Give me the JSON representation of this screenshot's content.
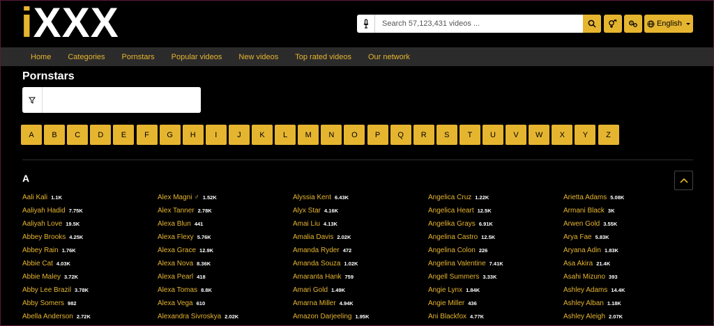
{
  "header": {
    "logo_i": "i",
    "logo_rest": "XXX",
    "search_placeholder": "Search 57,123,431 videos ...",
    "language": "English"
  },
  "nav": [
    "Home",
    "Categories",
    "Pornstars",
    "Popular videos",
    "New videos",
    "Top rated videos",
    "Our network"
  ],
  "page_title": "Pornstars",
  "letters": [
    "A",
    "B",
    "C",
    "D",
    "E",
    "F",
    "G",
    "H",
    "I",
    "J",
    "K",
    "L",
    "M",
    "N",
    "O",
    "P",
    "Q",
    "R",
    "S",
    "T",
    "U",
    "V",
    "W",
    "X",
    "Y",
    "Z"
  ],
  "section_letter": "A",
  "columns": [
    [
      {
        "name": "Aali Kali",
        "count": "1.1K"
      },
      {
        "name": "Aaliyah Hadid",
        "count": "7.75K"
      },
      {
        "name": "Aaliyah Love",
        "count": "19.5K"
      },
      {
        "name": "Abbey Brooks",
        "count": "4.25K"
      },
      {
        "name": "Abbey Rain",
        "count": "1.76K"
      },
      {
        "name": "Abbie Cat",
        "count": "4.03K"
      },
      {
        "name": "Abbie Maley",
        "count": "3.72K"
      },
      {
        "name": "Abby Lee Brazil",
        "count": "3.78K"
      },
      {
        "name": "Abby Somers",
        "count": "982"
      },
      {
        "name": "Abella Anderson",
        "count": "2.72K"
      }
    ],
    [
      {
        "name": "Alex Magni ♂",
        "count": "1.52K"
      },
      {
        "name": "Alex Tanner",
        "count": "2.78K"
      },
      {
        "name": "Alexa Blun",
        "count": "441"
      },
      {
        "name": "Alexa Flexy",
        "count": "5.76K"
      },
      {
        "name": "Alexa Grace",
        "count": "12.9K"
      },
      {
        "name": "Alexa Nova",
        "count": "8.36K"
      },
      {
        "name": "Alexa Pearl",
        "count": "418"
      },
      {
        "name": "Alexa Tomas",
        "count": "8.8K"
      },
      {
        "name": "Alexa Vega",
        "count": "610"
      },
      {
        "name": "Alexandra Sivroskya",
        "count": "2.02K"
      }
    ],
    [
      {
        "name": "Alyssia Kent",
        "count": "6.43K"
      },
      {
        "name": "Alyx Star",
        "count": "4.16K"
      },
      {
        "name": "Amai Liu",
        "count": "4.13K"
      },
      {
        "name": "Amalia Davis",
        "count": "2.02K"
      },
      {
        "name": "Amanda Ryder",
        "count": "472"
      },
      {
        "name": "Amanda Souza",
        "count": "1.02K"
      },
      {
        "name": "Amaranta Hank",
        "count": "759"
      },
      {
        "name": "Amari Gold",
        "count": "1.49K"
      },
      {
        "name": "Amarna Miller",
        "count": "4.94K"
      },
      {
        "name": "Amazon Darjeeling",
        "count": "1.95K"
      }
    ],
    [
      {
        "name": "Angelica Cruz",
        "count": "1.22K"
      },
      {
        "name": "Angelica Heart",
        "count": "12.5K"
      },
      {
        "name": "Angelika Grays",
        "count": "6.91K"
      },
      {
        "name": "Angelina Castro",
        "count": "12.5K"
      },
      {
        "name": "Angelina Colon",
        "count": "226"
      },
      {
        "name": "Angelina Valentine",
        "count": "7.41K"
      },
      {
        "name": "Angell Summers",
        "count": "3.33K"
      },
      {
        "name": "Angie Lynx",
        "count": "1.84K"
      },
      {
        "name": "Angie Miller",
        "count": "436"
      },
      {
        "name": "Ani Blackfox",
        "count": "4.77K"
      }
    ],
    [
      {
        "name": "Arietta Adams",
        "count": "5.08K"
      },
      {
        "name": "Armani Black",
        "count": "3K"
      },
      {
        "name": "Arwen Gold",
        "count": "3.55K"
      },
      {
        "name": "Arya Fae",
        "count": "5.83K"
      },
      {
        "name": "Aryana Adin",
        "count": "1.83K"
      },
      {
        "name": "Asa Akira",
        "count": "21.4K"
      },
      {
        "name": "Asahi Mizuno",
        "count": "393"
      },
      {
        "name": "Ashley Adams",
        "count": "14.4K"
      },
      {
        "name": "Ashley Alban",
        "count": "1.18K"
      },
      {
        "name": "Ashley Aleigh",
        "count": "2.07K"
      }
    ]
  ]
}
